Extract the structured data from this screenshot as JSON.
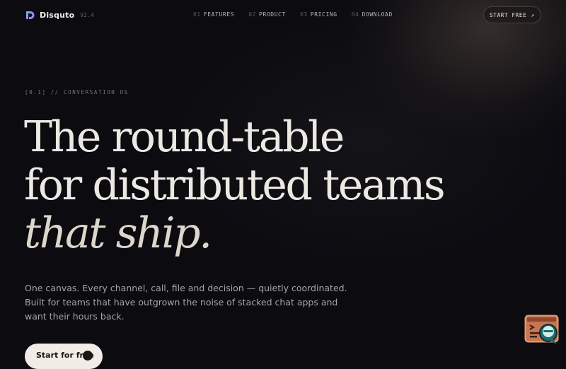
{
  "brand": {
    "name": "Disquto",
    "version": "V2.4",
    "icon": "disquto-logo-icon"
  },
  "nav": {
    "items": [
      {
        "num": "01",
        "label": "FEATURES"
      },
      {
        "num": "02",
        "label": "PRODUCT"
      },
      {
        "num": "03",
        "label": "PRICING"
      },
      {
        "num": "04",
        "label": "DOWNLOAD"
      }
    ],
    "cta": {
      "label": "START FREE",
      "icon": "arrow-up-right-icon"
    }
  },
  "hero": {
    "eyebrow": "[0.1] // CONVERSATION OS",
    "headline": {
      "line1": "The round-table",
      "line2": "for distributed teams",
      "line3": "that ship."
    },
    "subtext": "One canvas. Every channel, call, file and decision — quietly coordinated. Built for teams that have outgrown the noise of stacked chat apps and want their hours back.",
    "primary_button": {
      "label": "Start for free",
      "icon": "arrow-circle-icon"
    }
  },
  "floating_widget": {
    "icon": "chat-assistant-icon"
  },
  "colors": {
    "background": "#0b0b10",
    "text": "#ece8e2",
    "muted": "#a9a5a0",
    "accent_logo": "#9b6cff",
    "widget": "#e0835a"
  }
}
